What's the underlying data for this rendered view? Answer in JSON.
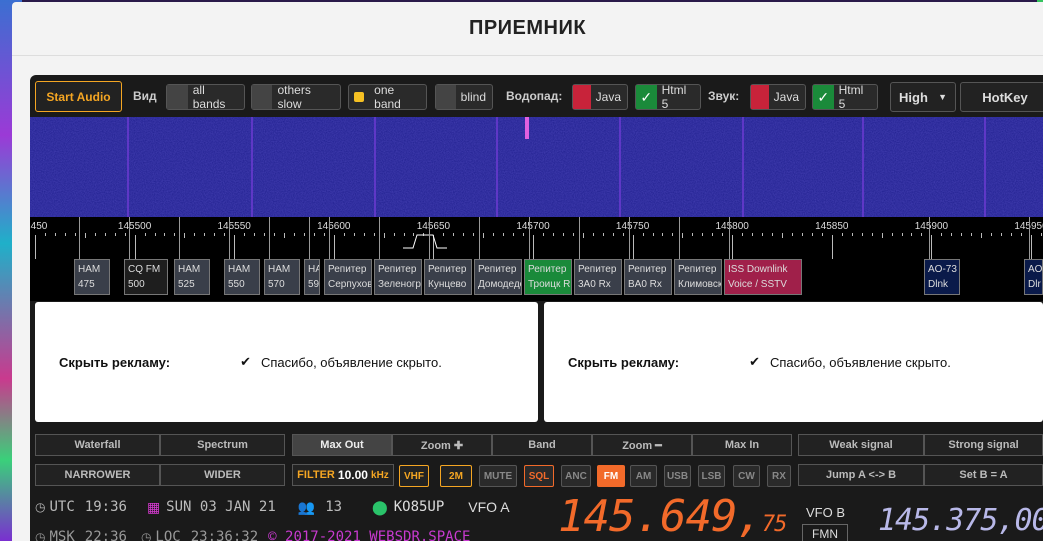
{
  "title": "ПРИЕМНИК",
  "toolbar": {
    "start_audio": "Start Audio",
    "view_label": "Вид",
    "all_bands": "all bands",
    "others_slow": "others slow",
    "one_band": "one band",
    "blind": "blind",
    "waterfall_label": "Водопад:",
    "wf_java": "Java",
    "wf_html5": "Html 5",
    "sound_label": "Звук:",
    "snd_java": "Java",
    "snd_html5": "Html 5",
    "quality": "High",
    "hotkey": "HotKey"
  },
  "scale": {
    "labels": [
      "450",
      "145500",
      "145550",
      "145600",
      "145650",
      "145700",
      "145750",
      "145800",
      "145850",
      "145900",
      "145950"
    ]
  },
  "bookmarks": [
    {
      "l1": "HAM",
      "l2": "475"
    },
    {
      "l1": "CQ FM",
      "l2": "500"
    },
    {
      "l1": "HAM",
      "l2": "525"
    },
    {
      "l1": "HAM",
      "l2": "550"
    },
    {
      "l1": "HAM",
      "l2": "570"
    },
    {
      "l1": "HA",
      "l2": "59"
    },
    {
      "l1": "Репитер",
      "l2": "Серпухов"
    },
    {
      "l1": "Репитер",
      "l2": "Зеленоград"
    },
    {
      "l1": "Репитер",
      "l2": "Кунцево"
    },
    {
      "l1": "Репитер",
      "l2": "Домодедово"
    },
    {
      "l1": "Репитер",
      "l2": "Троицк R"
    },
    {
      "l1": "Репитер",
      "l2": "3A0 Rx"
    },
    {
      "l1": "Репитер",
      "l2": "BA0 Rx"
    },
    {
      "l1": "Репитер",
      "l2": "Климовск"
    },
    {
      "l1": "ISS Downlink",
      "l2": "Voice / SSTV"
    },
    {
      "l1": "AO-73",
      "l2": "Dlnk"
    },
    {
      "l1": "AO-",
      "l2": "Dlr"
    }
  ],
  "ads": [
    {
      "label": "Скрыть рекламу:",
      "msg": "Спасибо, объявление скрыто."
    },
    {
      "label": "Скрыть рекламу:",
      "msg": "Спасибо, объявление скрыто."
    }
  ],
  "controls": {
    "waterfall": "Waterfall",
    "spectrum": "Spectrum",
    "maxout": "Max Out",
    "zoom_plus": "Zoom ✚",
    "band": "Band",
    "zoom_minus": "Zoom ━",
    "maxin": "Max In",
    "weak": "Weak signal",
    "strong": "Strong signal",
    "narrower": "NARROWER",
    "wider": "WIDER",
    "filter_label": "FILTER",
    "filter_val": "10.00",
    "filter_unit": "kHz",
    "vhf": "VHF",
    "twom": "2M",
    "mute": "MUTE",
    "sql": "SQL",
    "anc": "ANC",
    "fm": "FM",
    "am": "AM",
    "usb": "USB",
    "lsb": "LSB",
    "cw": "CW",
    "rx": "RX",
    "jump": "Jump A <-> B",
    "setb": "Set B = A"
  },
  "status": {
    "utc_label": "UTC",
    "utc": "19:36",
    "date": "SUN 03 JAN 21",
    "users": "13",
    "locator": "KO85UP",
    "vfo_a": "VFO A",
    "msk_label": "MSK",
    "msk": "22:36",
    "loc_label": "LOC",
    "loc": "23:36:32",
    "copyright": "© 2017-2021 WEBSDR.SPACE"
  },
  "freq": {
    "main": "145.649,",
    "main_sub": "75",
    "vfo_b": "VFO B",
    "fmn": "FMN",
    "second": "145.375,00"
  },
  "colors": {
    "accent": "#f5a623",
    "green": "#1a8a3a",
    "red": "#c8233a",
    "orange": "#f26a2a"
  }
}
